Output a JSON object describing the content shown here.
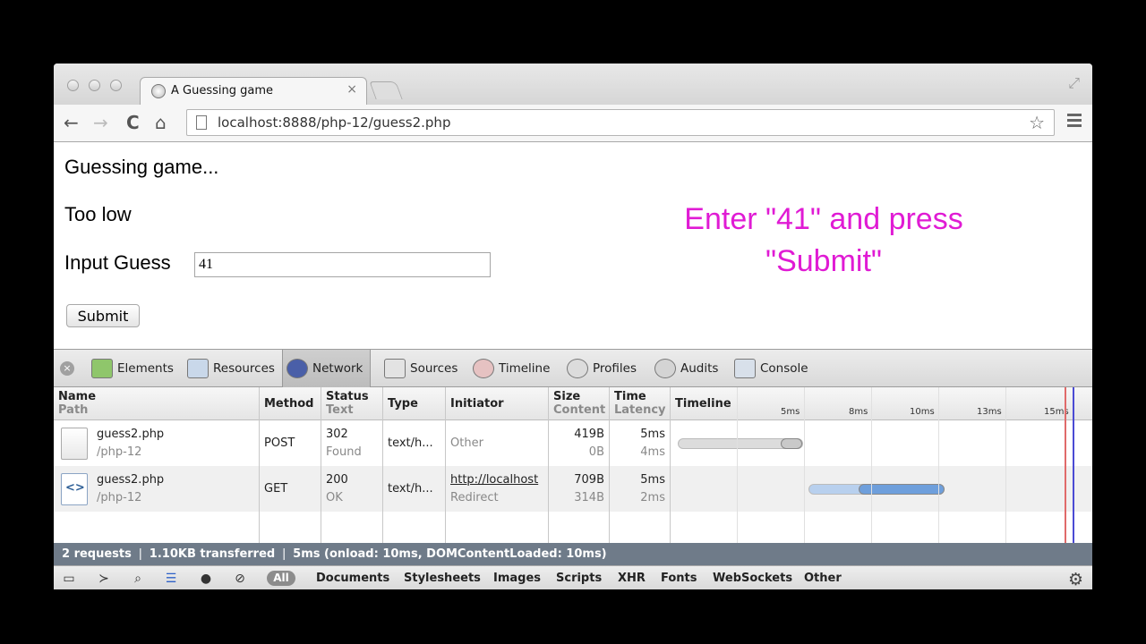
{
  "browser": {
    "tab_title": "A Guessing game",
    "tab_close": "×",
    "url": "localhost:8888/php-12/guess2.php",
    "back": "←",
    "forward": "→",
    "reload": "C",
    "home": "⌂",
    "star": "☆",
    "fullscreen": "⤢"
  },
  "page": {
    "heading": "Guessing game...",
    "feedback": "Too low",
    "input_label": "Input Guess",
    "input_value": "41",
    "submit_label": "Submit",
    "annotation_line1": "Enter \"41\" and press",
    "annotation_line2": "\"Submit\""
  },
  "devtools": {
    "close": "×",
    "tabs": [
      "Elements",
      "Resources",
      "Network",
      "Sources",
      "Timeline",
      "Profiles",
      "Audits",
      "Console"
    ],
    "active_tab": "Network",
    "columns": {
      "name": "Name",
      "path": "Path",
      "method": "Method",
      "status": "Status",
      "text": "Text",
      "type": "Type",
      "initiator": "Initiator",
      "size": "Size",
      "content": "Content",
      "time": "Time",
      "latency": "Latency",
      "timeline": "Timeline"
    },
    "ticks": [
      "5ms",
      "8ms",
      "10ms",
      "13ms",
      "15ms"
    ],
    "requests": [
      {
        "name": "guess2.php",
        "path": "/php-12",
        "method": "POST",
        "status": "302",
        "status_text": "Found",
        "type": "text/h...",
        "initiator": "Other",
        "initiator_sub": "",
        "size": "419B",
        "content": "0B",
        "time": "5ms",
        "latency": "4ms",
        "bar_start_ms": 0,
        "bar_end_ms": 4.5,
        "latency_start_ms": 3.7
      },
      {
        "name": "guess2.php",
        "path": "/php-12",
        "method": "GET",
        "status": "200",
        "status_text": "OK",
        "type": "text/h...",
        "initiator": "http://localhost",
        "initiator_sub": "Redirect",
        "size": "709B",
        "content": "314B",
        "time": "5ms",
        "latency": "2ms",
        "bar_start_ms": 4.7,
        "bar_end_ms": 9.6,
        "latency_start_ms": 6.5
      }
    ],
    "summary": "2 requests  ❘  1.10KB transferred  ❘  5ms (onload: 10ms, DOMContentLoaded: 10ms)",
    "filters": [
      "All",
      "Documents",
      "Stylesheets",
      "Images",
      "Scripts",
      "XHR",
      "Fonts",
      "WebSockets",
      "Other"
    ],
    "settings": "⚙"
  },
  "colors": {
    "annotation": "#e01bd4",
    "summary_bar": "#6f7b89",
    "bar_wait": "#c9c9c9",
    "bar_blue": "#6e9fdc"
  }
}
